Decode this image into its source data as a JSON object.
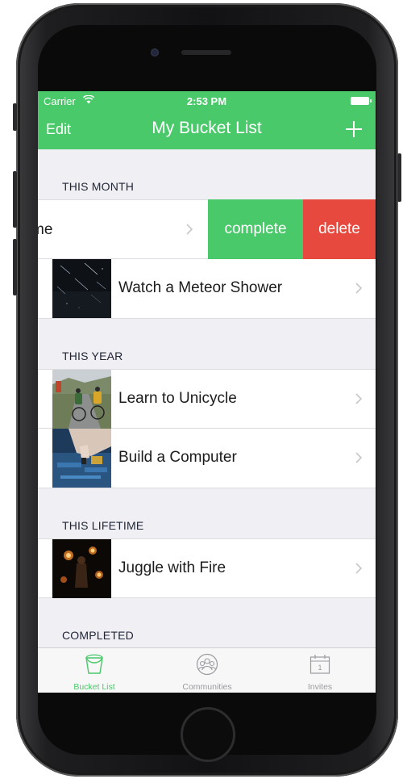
{
  "colors": {
    "brand_green": "#49c96a",
    "delete_red": "#e8493f",
    "background": "#efeff4"
  },
  "status_bar": {
    "carrier": "Carrier",
    "time": "2:53 PM",
    "wifi_icon": "wifi-icon",
    "battery_icon": "battery-icon"
  },
  "nav_bar": {
    "edit_label": "Edit",
    "title": "My Bucket List",
    "add_icon": "plus-icon"
  },
  "sections": [
    {
      "header": "THIS MONTH",
      "items": [
        {
          "label": "me",
          "swiped": true,
          "actions": [
            "complete",
            "delete"
          ]
        },
        {
          "label": "Watch a Meteor Shower",
          "thumbnail": "meteor-shower-photo"
        }
      ]
    },
    {
      "header": "THIS YEAR",
      "items": [
        {
          "label": "Learn to Unicycle",
          "thumbnail": "cyclists-photo"
        },
        {
          "label": "Build a Computer",
          "thumbnail": "motherboard-photo"
        }
      ]
    },
    {
      "header": "THIS LIFETIME",
      "items": [
        {
          "label": "Juggle with Fire",
          "thumbnail": "fire-juggling-photo"
        }
      ]
    },
    {
      "header": "COMPLETED",
      "items": []
    }
  ],
  "swipe_actions": {
    "complete_label": "complete",
    "delete_label": "delete"
  },
  "tab_bar": {
    "tabs": [
      {
        "label": "Bucket List",
        "icon": "bucket-icon",
        "active": true
      },
      {
        "label": "Communities",
        "icon": "people-icon",
        "active": false
      },
      {
        "label": "Invites",
        "icon": "calendar-icon",
        "active": false,
        "icon_text": "1"
      }
    ]
  }
}
